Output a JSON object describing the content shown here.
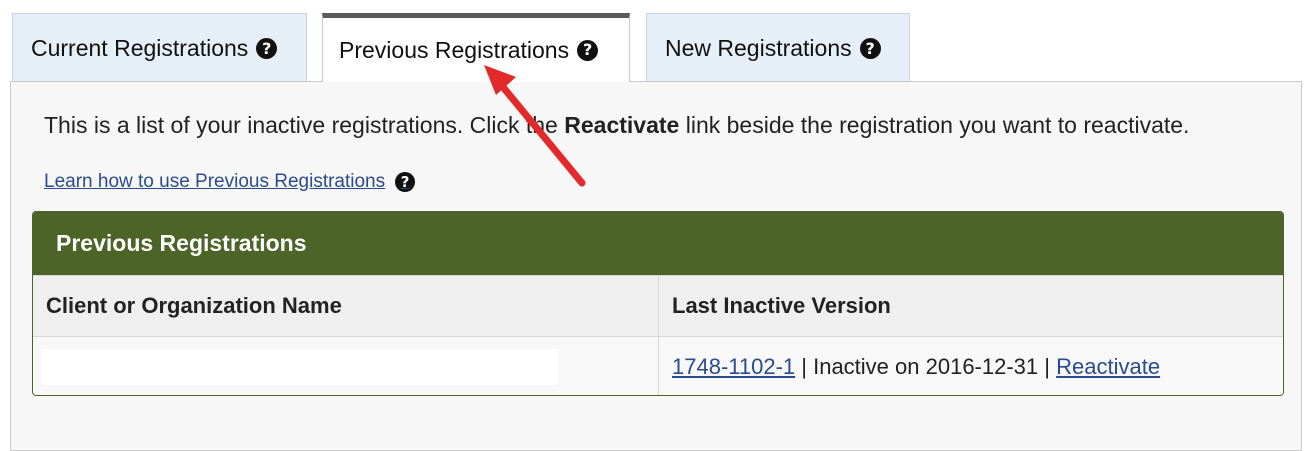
{
  "tabs": [
    {
      "label": "Current Registrations",
      "icon": "help-circle-icon",
      "active": false
    },
    {
      "label": "Previous Registrations",
      "icon": "help-circle-icon",
      "active": true
    },
    {
      "label": "New Registrations",
      "icon": "help-circle-icon",
      "active": false
    }
  ],
  "intro": {
    "before": "This is a list of your inactive registrations. Click the ",
    "bold": "Reactivate",
    "after": " link beside the registration you want to reactivate."
  },
  "learn_link": "Learn how to use Previous Registrations",
  "table": {
    "title": "Previous Registrations",
    "headers": [
      "Client or Organization Name",
      "Last Inactive Version"
    ],
    "rows": [
      {
        "client_name": "",
        "version_link": "1748-1102-1",
        "separator1": " | ",
        "status": "Inactive on 2016-12-31",
        "separator2": " | ",
        "action_link": "Reactivate"
      }
    ]
  },
  "colors": {
    "table_header_green": "#4d6428",
    "link_blue": "#2a4b8d",
    "tab_inactive_bg": "#e6eef8",
    "annotation_arrow": "#e32a2a"
  }
}
